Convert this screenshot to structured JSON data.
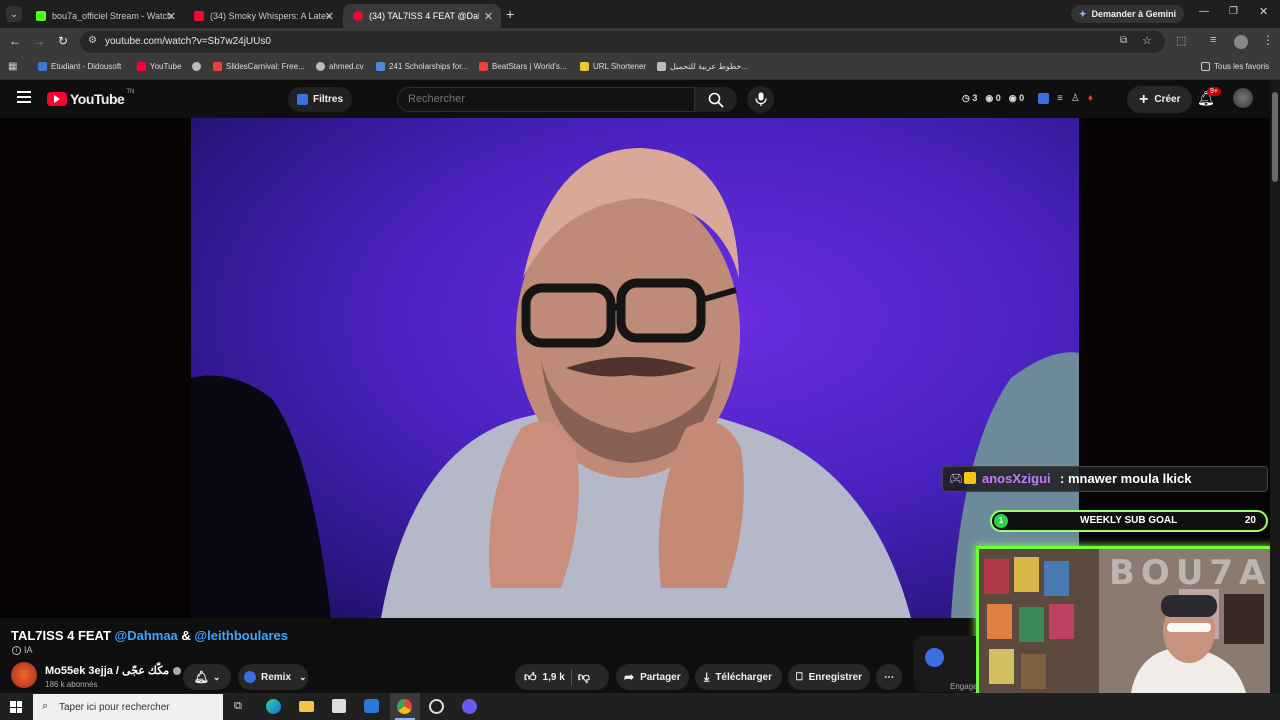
{
  "browser": {
    "tabs": [
      {
        "label": "bou7a_officiel Stream - Watch l",
        "color": "#53fc18"
      },
      {
        "label": "(34) Smoky Whispers: A Late-N",
        "color": "#ff0033"
      },
      {
        "label": "(34) TAL7ISS 4 FEAT @Dahmaa",
        "color": "#ff0033"
      }
    ],
    "gemini_label": "Demander à Gemini",
    "url": "youtube.com/watch?v=Sb7w24jUUs0",
    "bookmarks": [
      {
        "label": "Etudiant - Didousoft",
        "color": "#3a78d8"
      },
      {
        "label": "YouTube",
        "color": "#ff0033"
      },
      {
        "label": "",
        "color": "#bbbbbb"
      },
      {
        "label": "SlidesCarnival: Free...",
        "color": "#e8443a"
      },
      {
        "label": "ahmed.cv",
        "color": "#bbbbbb"
      },
      {
        "label": "241 Scholarships for...",
        "color": "#4a8ad8"
      },
      {
        "label": "BeatStars | World's...",
        "color": "#e8443a"
      },
      {
        "label": "URL Shortener",
        "color": "#e8c83a"
      },
      {
        "label": "خطوط عربية للتحميل...",
        "color": "#bbbbbb"
      }
    ],
    "all_bookmarks": "Tous les favoris"
  },
  "youtube": {
    "logo": "YouTube",
    "logo_suffix": "TN",
    "filters_label": "Filtres",
    "search_placeholder": "Rechercher",
    "stats": [
      "3",
      "0",
      "0"
    ],
    "create_label": "Créer",
    "notif_badge": "9+"
  },
  "overlay": {
    "chat_user": "anosXzigui",
    "chat_message": ": mnawer moula lkick",
    "goal_level": "1",
    "goal_label": "WEEKLY SUB GOAL",
    "goal_target": "20",
    "wall_text": "BOU7A"
  },
  "video": {
    "title_prefix": "TAL7ISS 4 FEAT ",
    "mention1": "@Dahmaa",
    "amp": " & ",
    "mention2": "@leithboulares",
    "ai_label": "IA",
    "channel_name": "Mo55ek 3ejja / مكّك عجّى",
    "subscribers": "186 k abonnés",
    "remix_label": "Remix",
    "likes": "1,9 k",
    "share_label": "Partager",
    "download_label": "Télécharger",
    "save_label": "Enregistrer",
    "engagement_label": "Engage"
  },
  "taskbar": {
    "search_placeholder": "Taper ici pour rechercher"
  }
}
